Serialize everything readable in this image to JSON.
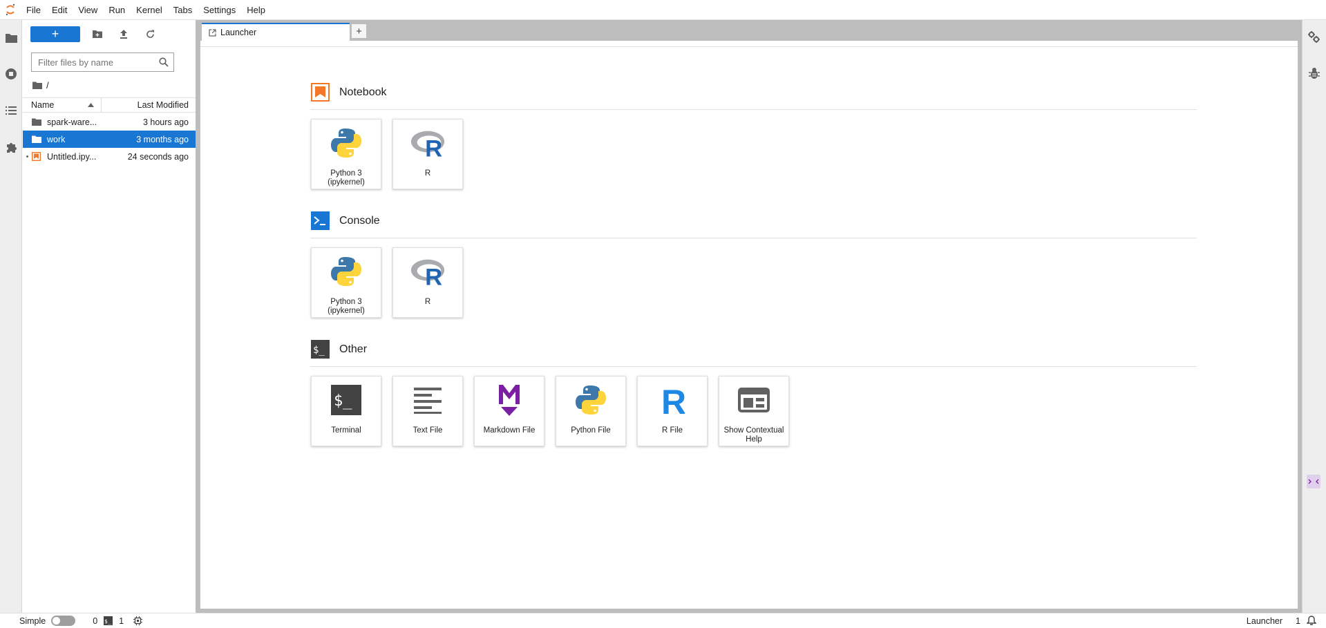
{
  "menu": [
    "File",
    "Edit",
    "View",
    "Run",
    "Kernel",
    "Tabs",
    "Settings",
    "Help"
  ],
  "filebrowser": {
    "new_label": "+",
    "filter_placeholder": "Filter files by name",
    "breadcrumb": "/",
    "col_name": "Name",
    "col_modified": "Last Modified",
    "rows": [
      {
        "name": "spark-ware...",
        "modified": "3 hours ago",
        "type": "folder"
      },
      {
        "name": "work",
        "modified": "3 months ago",
        "type": "folder"
      },
      {
        "name": "Untitled.ipy...",
        "modified": "24 seconds ago",
        "type": "notebook"
      }
    ]
  },
  "tabs": [
    {
      "label": "Launcher"
    }
  ],
  "add_tab_label": "+",
  "launcher": {
    "notebook": {
      "title": "Notebook",
      "cards": [
        {
          "label": "Python 3 (ipykernel)"
        },
        {
          "label": "R"
        }
      ]
    },
    "console": {
      "title": "Console",
      "cards": [
        {
          "label": "Python 3 (ipykernel)"
        },
        {
          "label": "R"
        }
      ]
    },
    "other": {
      "title": "Other",
      "cards": [
        {
          "label": "Terminal"
        },
        {
          "label": "Text File"
        },
        {
          "label": "Markdown File"
        },
        {
          "label": "Python File"
        },
        {
          "label": "R File"
        },
        {
          "label": "Show Contextual Help"
        }
      ]
    }
  },
  "status": {
    "mode": "Simple",
    "kernels": "0",
    "terminals": "1",
    "right_label": "Launcher",
    "right_count": "1"
  },
  "colors": {
    "accent": "#1976d2",
    "notebook_orange": "#f37726",
    "markdown_purple": "#7b1fa2"
  }
}
